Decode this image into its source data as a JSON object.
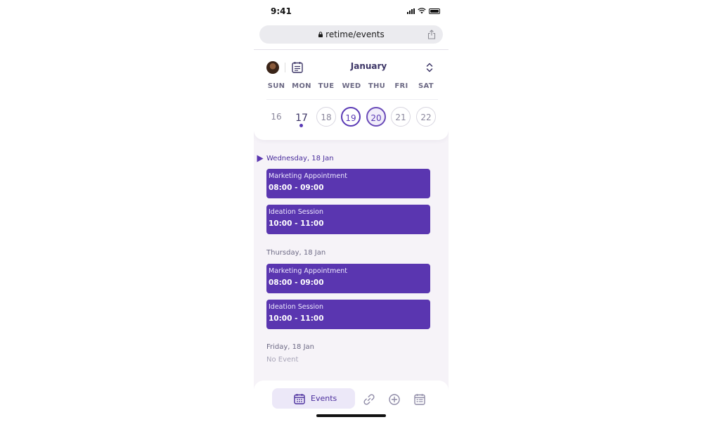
{
  "status_bar": {
    "time": "9:41"
  },
  "browser": {
    "url": "retime/events"
  },
  "calendar": {
    "month": "January",
    "weekdays": [
      "SUN",
      "MON",
      "TUE",
      "WED",
      "THU",
      "FRI",
      "SAT"
    ],
    "dates": [
      "16",
      "17",
      "18",
      "19",
      "20",
      "21",
      "22"
    ],
    "today": "17",
    "selected": [
      "19",
      "20"
    ]
  },
  "schedule": {
    "days": [
      {
        "label": "Wednesday, 18 Jan",
        "events": [
          {
            "title": "Marketing Appointment",
            "time": "08:00 - 09:00"
          },
          {
            "title": "Ideation Session",
            "time": "10:00 - 11:00"
          }
        ]
      },
      {
        "label": "Thursday, 18 Jan",
        "events": [
          {
            "title": "Marketing Appointment",
            "time": "08:00 - 09:00"
          },
          {
            "title": "Ideation Session",
            "time": "10:00 - 11:00"
          }
        ]
      },
      {
        "label": "Friday, 18 Jan",
        "empty_text": "No Event"
      }
    ]
  },
  "bottom_nav": {
    "active_label": "Events",
    "items": [
      "calendar-icon",
      "link-icon",
      "add-circle-icon",
      "schedule-list-icon"
    ]
  },
  "colors": {
    "accent": "#5a36b0",
    "accent_text": "#4a2d9c",
    "background": "#f6f3f8"
  }
}
